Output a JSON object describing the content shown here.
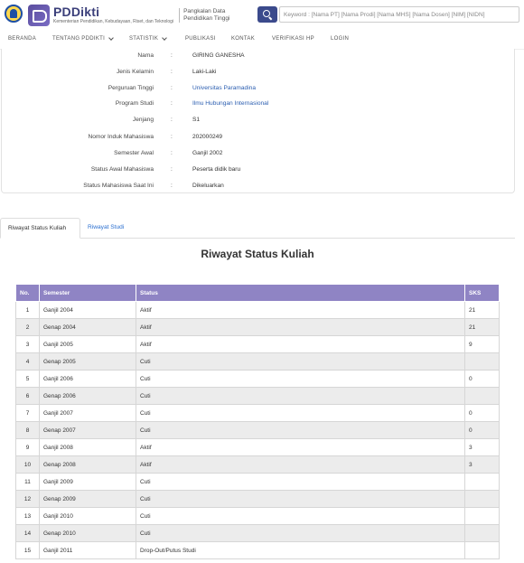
{
  "header": {
    "brand_name": "PDDikti",
    "brand_sub": "Kementerian Pendidikan, Kebudayaan, Riset, dan Teknologi",
    "tagline_line1": "Pangkalan Data",
    "tagline_line2": "Pendidikan Tinggi",
    "search_placeholder": "Keyword : [Nama PT] [Nama Prodi] [Nama MHS] [Nama Dosen] [NIM] [NIDN]",
    "accent_color": "#3b4a8c"
  },
  "nav": {
    "items": [
      "BERANDA",
      "TENTANG PDDIKTI",
      "STATISTIK",
      "PUBLIKASI",
      "KONTAK",
      "VERIFIKASI HP",
      "LOGIN"
    ]
  },
  "student": {
    "fields": [
      {
        "label": "Nama",
        "value": "GIRING GANESHA"
      },
      {
        "label": "Jenis Kelamin",
        "value": "Laki-Laki"
      },
      {
        "label": "Perguruan Tinggi",
        "value": "Universitas Paramadina"
      },
      {
        "label": "Program Studi",
        "value": "Ilmu Hubungan Internasional"
      },
      {
        "label": "Jenjang",
        "value": "S1"
      },
      {
        "label": "Nomor Induk Mahasiswa",
        "value": "202000249"
      },
      {
        "label": "Semester Awal",
        "value": "Ganjil 2002"
      },
      {
        "label": "Status Awal Mahasiswa",
        "value": "Peserta didik baru"
      },
      {
        "label": "Status Mahasiswa Saat Ini",
        "value": "Dikeluarkan"
      }
    ]
  },
  "tabs": [
    "Riwayat Status Kuliah",
    "Riwayat Studi"
  ],
  "section_title": "Riwayat Status Kuliah",
  "table": {
    "headers": [
      "No.",
      "Semester",
      "Status",
      "SKS"
    ],
    "rows": [
      [
        "1",
        "Ganjil 2004",
        "Aktif",
        "21"
      ],
      [
        "2",
        "Genap 2004",
        "Aktif",
        "21"
      ],
      [
        "3",
        "Ganjil 2005",
        "Aktif",
        "9"
      ],
      [
        "4",
        "Genap 2005",
        "Cuti",
        ""
      ],
      [
        "5",
        "Ganjil 2006",
        "Cuti",
        "0"
      ],
      [
        "6",
        "Genap 2006",
        "Cuti",
        ""
      ],
      [
        "7",
        "Ganjil 2007",
        "Cuti",
        "0"
      ],
      [
        "8",
        "Genap 2007",
        "Cuti",
        "0"
      ],
      [
        "9",
        "Ganjil 2008",
        "Aktif",
        "3"
      ],
      [
        "10",
        "Genap 2008",
        "Aktif",
        "3"
      ],
      [
        "11",
        "Ganjil 2009",
        "Cuti",
        ""
      ],
      [
        "12",
        "Genap 2009",
        "Cuti",
        ""
      ],
      [
        "13",
        "Ganjil 2010",
        "Cuti",
        ""
      ],
      [
        "14",
        "Genap 2010",
        "Cuti",
        ""
      ],
      [
        "15",
        "Ganjil 2011",
        "Drop-Out/Putus Studi",
        ""
      ]
    ],
    "header_color": "#8f84c4"
  }
}
